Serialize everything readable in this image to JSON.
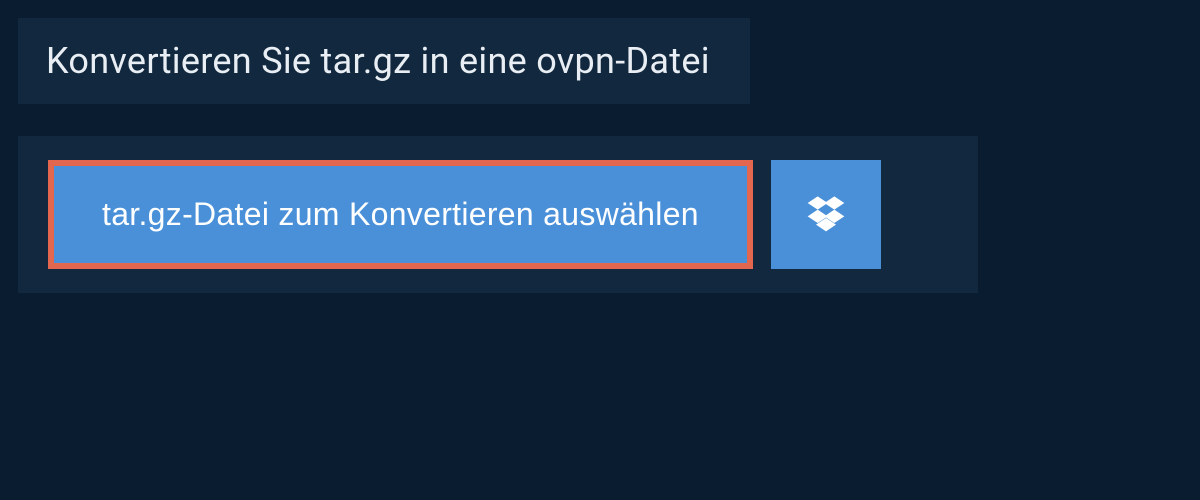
{
  "header": {
    "title": "Konvertieren Sie tar.gz in eine ovpn-Datei"
  },
  "upload": {
    "select_file_label": "tar.gz-Datei zum Konvertieren auswählen",
    "dropbox_icon": "dropbox-icon"
  }
}
